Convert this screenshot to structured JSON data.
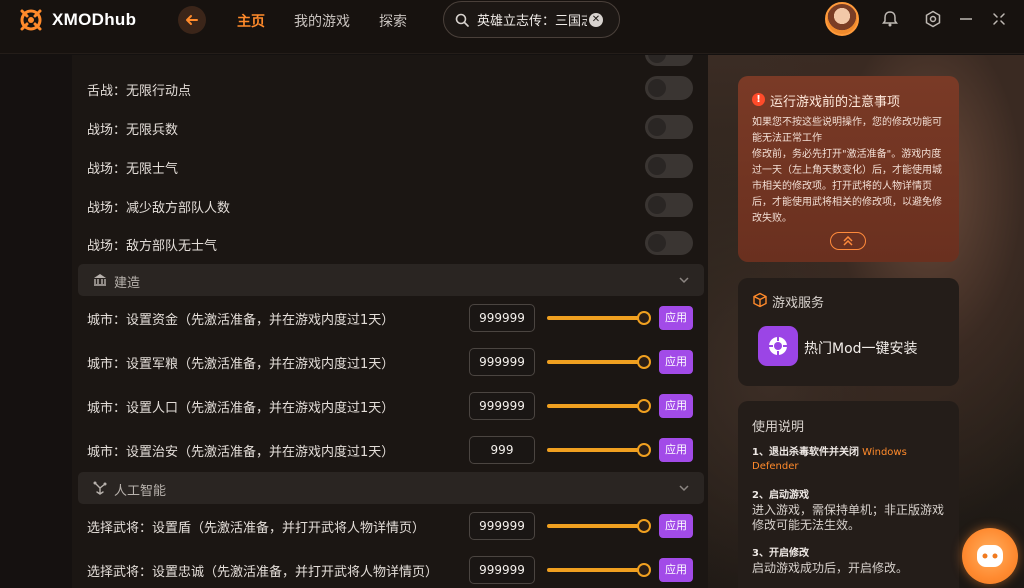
{
  "app": {
    "logo_text": "XMODhub"
  },
  "nav": {
    "tabs": [
      "主页",
      "我的游戏",
      "探索"
    ],
    "active": 0
  },
  "search": {
    "value": "英雄立志传：三国志"
  },
  "cheats": [
    {
      "label": "舌战：无限行动点",
      "enabled": false
    },
    {
      "label": "战场：无限兵数",
      "enabled": false
    },
    {
      "label": "战场：无限士气",
      "enabled": false
    },
    {
      "label": "战场：减少敌方部队人数",
      "enabled": false
    },
    {
      "label": "战场：敌方部队无士气",
      "enabled": false
    }
  ],
  "sections": {
    "build": "建造",
    "ai": "人工智能"
  },
  "build_rows": [
    {
      "label": "城市：设置资金（先激活准备，并在游戏内度过1天）",
      "value": "999999",
      "level": 1.0,
      "button": "应用"
    },
    {
      "label": "城市：设置军粮（先激活准备，并在游戏内度过1天）",
      "value": "999999",
      "level": 1.0,
      "button": "应用"
    },
    {
      "label": "城市：设置人口（先激活准备，并在游戏内度过1天）",
      "value": "999999",
      "level": 1.0,
      "button": "应用"
    },
    {
      "label": "城市：设置治安（先激活准备，并在游戏内度过1天）",
      "value": "999",
      "level": 1.0,
      "button": "应用"
    }
  ],
  "ai_rows": [
    {
      "label": "选择武将：设置盾（先激活准备，并打开武将人物详情页）",
      "value": "999999",
      "level": 1.0,
      "button": "应用"
    },
    {
      "label": "选择武将：设置忠诚（先激活准备，并打开武将人物详情页）",
      "value": "999999",
      "level": 1.0,
      "button": "应用"
    }
  ],
  "warning": {
    "title": "运行游戏前的注意事项",
    "line1": "如果您不按这些说明操作，您的修改功能可能无法正常工作",
    "line2": "修改前，务必先打开\"激活准备\"。游戏内度过一天（左上角天数变化）后，才能使用城市相关的修改项。打开武将的人物详情页后，才能使用武将相关的修改项，以避免修改失败。"
  },
  "service": {
    "title": "游戏服务",
    "mod_label": "热门Mod一键安装"
  },
  "guide": {
    "title": "使用说明",
    "step1_title": "1、退出杀毒软件并关闭",
    "step1_highlight": "Windows Defender",
    "step2_title": "2、启动游戏",
    "step2_desc": "进入游戏，需保持单机；非正版游戏修改可能无法生效。",
    "step3_title": "3、开启修改",
    "step3_desc": "启动游戏成功后，开启修改。"
  },
  "colors": {
    "accent": "#ff8a2b",
    "apply": "#a24be8",
    "slider": "#f0a020",
    "warning_bg": "#7a3a26"
  }
}
